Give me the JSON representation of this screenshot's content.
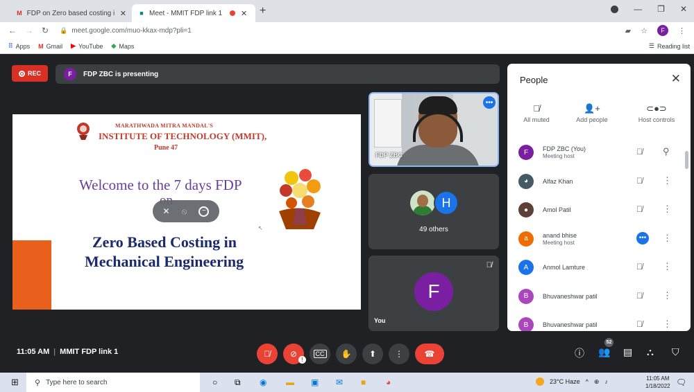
{
  "browser": {
    "tabs": [
      {
        "icon": "gmail-icon",
        "label": "FDP on Zero based costing in Me"
      },
      {
        "icon": "meet-icon",
        "label": "Meet - MMIT FDP link 1"
      }
    ],
    "new_tab": "+",
    "url": "meet.google.com/muo-kkax-mdp?pli=1",
    "profile_initial": "F",
    "bookmarks": [
      {
        "icon": "apps-icon",
        "label": "Apps"
      },
      {
        "icon": "gmail-icon",
        "label": "Gmail"
      },
      {
        "icon": "youtube-icon",
        "label": "YouTube"
      },
      {
        "icon": "maps-icon",
        "label": "Maps"
      }
    ],
    "reading_list": "Reading list"
  },
  "meet": {
    "rec_label": "REC",
    "presenter_initial": "F",
    "presenting_text": "FDP ZBC is presenting",
    "slide": {
      "org_line1": "MARATHWADA MITRA MANDAL'S",
      "org_line2": "INSTITUTE OF TECHNOLOGY (MMIT),",
      "org_line3": "Pune 47",
      "welcome": "Welcome to the 7 days FDP",
      "on": "on",
      "title_line1": "Zero Based Costing in",
      "title_line2": "Mechanical Engineering"
    },
    "tiles": {
      "presenter_name": "FDP ZBC",
      "others_initial": "H",
      "others_label": "49 others",
      "you_initial": "F",
      "you_label": "You"
    },
    "meeting_time": "11:05 AM",
    "meeting_name": "MMIT FDP link 1",
    "people_count": "52",
    "cam_badge": "!"
  },
  "people_panel": {
    "title": "People",
    "actions": [
      {
        "icon": "mic-off-icon",
        "label": "All muted"
      },
      {
        "icon": "add-person-icon",
        "label": "Add people"
      },
      {
        "icon": "toggle-icon",
        "label": "Host controls"
      }
    ],
    "participants": [
      {
        "initial": "F",
        "color": "#7b1fa2",
        "name": "FDP ZBC (You)",
        "role": "Meeting host"
      },
      {
        "initial": "",
        "color": "#455a64",
        "name": "Alfaz Khan",
        "role": ""
      },
      {
        "initial": "",
        "color": "#5d4037",
        "name": "Amol Patil",
        "role": ""
      },
      {
        "initial": "a",
        "color": "#ef6c00",
        "name": "anand bhise",
        "role": "Meeting host"
      },
      {
        "initial": "A",
        "color": "#1a73e8",
        "name": "Anmol Lamture",
        "role": ""
      },
      {
        "initial": "B",
        "color": "#ab47bc",
        "name": "Bhuvaneshwar patil",
        "role": ""
      },
      {
        "initial": "B",
        "color": "#ab47bc",
        "name": "Bhuvaneshwar patil",
        "role": ""
      }
    ]
  },
  "taskbar": {
    "search_placeholder": "Type here to search",
    "weather": "23°C Haze",
    "time": "11:05 AM",
    "date": "1/18/2022"
  }
}
